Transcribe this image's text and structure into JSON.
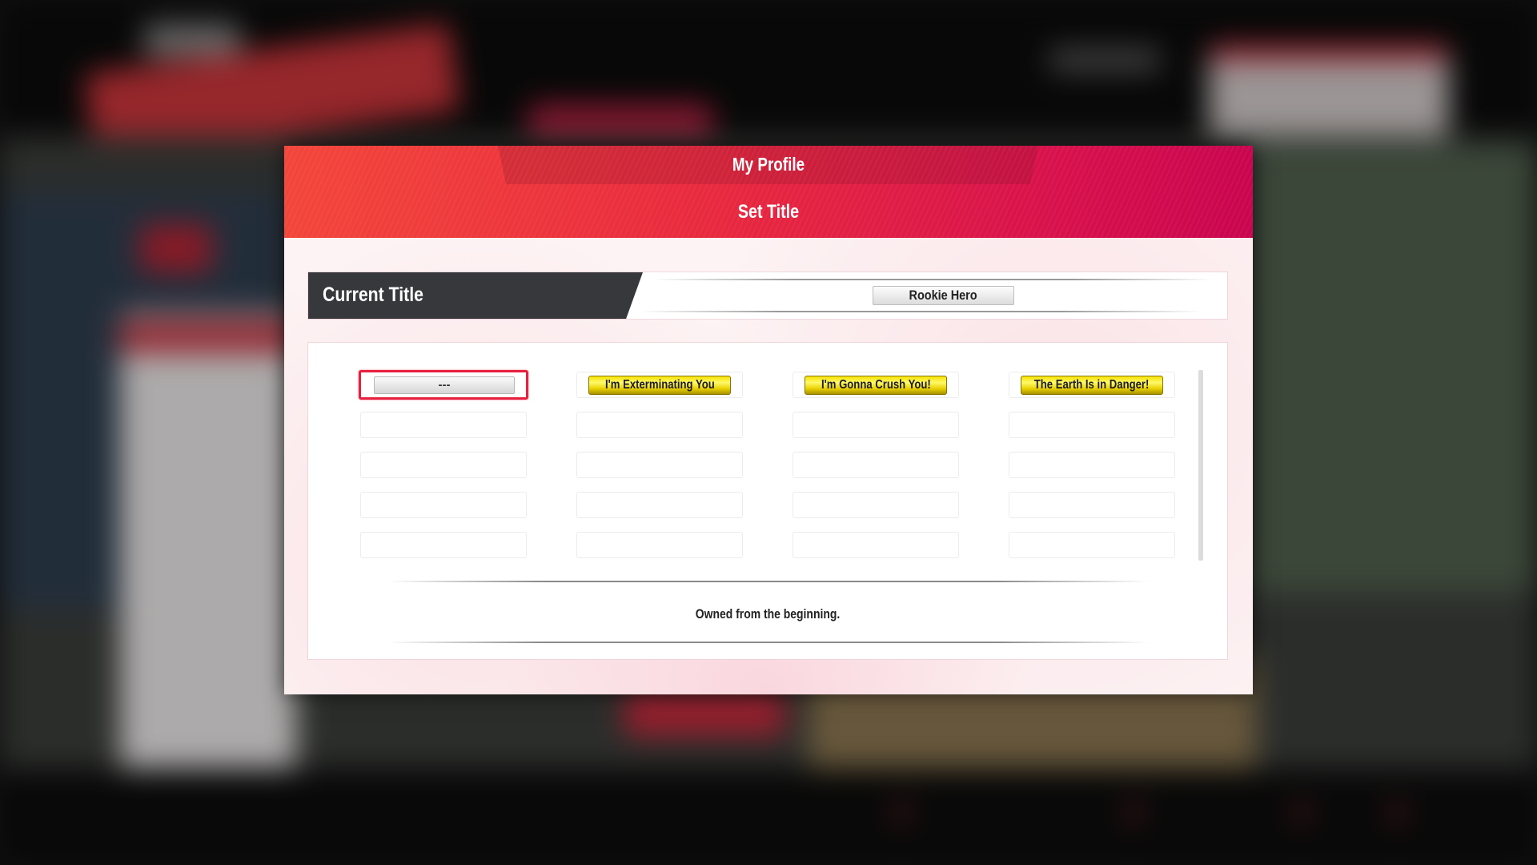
{
  "dialog": {
    "section": "My Profile",
    "title": "Set Title"
  },
  "current_title": {
    "label": "Current Title",
    "value": "Rookie Hero"
  },
  "titles": {
    "grid": [
      {
        "label": "---",
        "style": "plain",
        "selected": true
      },
      {
        "label": "I'm Exterminating You",
        "style": "gold",
        "selected": false
      },
      {
        "label": "I'm Gonna Crush You!",
        "style": "gold",
        "selected": false
      },
      {
        "label": "The Earth Is in Danger!",
        "style": "gold",
        "selected": false
      },
      {
        "label": "",
        "style": "empty"
      },
      {
        "label": "",
        "style": "empty"
      },
      {
        "label": "",
        "style": "empty"
      },
      {
        "label": "",
        "style": "empty"
      },
      {
        "label": "",
        "style": "empty"
      },
      {
        "label": "",
        "style": "empty"
      },
      {
        "label": "",
        "style": "empty"
      },
      {
        "label": "",
        "style": "empty"
      },
      {
        "label": "",
        "style": "empty"
      },
      {
        "label": "",
        "style": "empty"
      },
      {
        "label": "",
        "style": "empty"
      },
      {
        "label": "",
        "style": "empty"
      },
      {
        "label": "",
        "style": "empty"
      },
      {
        "label": "",
        "style": "empty"
      },
      {
        "label": "",
        "style": "empty"
      },
      {
        "label": "",
        "style": "empty"
      }
    ],
    "description": "Owned from the beginning."
  },
  "colors": {
    "header_start": "#f3463a",
    "header_end": "#c9054f",
    "selection": "#e8203f",
    "gold_plate": "#f6e200",
    "label_bar": "#36383b"
  }
}
